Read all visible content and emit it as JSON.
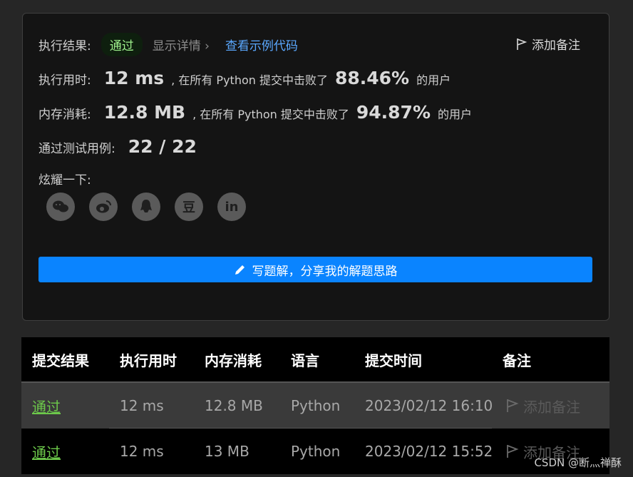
{
  "result": {
    "label": "执行结果:",
    "status": "通过",
    "detail": "显示详情 ›",
    "example": "查看示例代码",
    "add_note": "添加备注"
  },
  "runtime": {
    "label": "执行用时:",
    "value": "12 ms",
    "prefix": ", 在所有 Python 提交中击败了",
    "percent": "88.46%",
    "suffix": "的用户"
  },
  "memory": {
    "label": "内存消耗:",
    "value": "12.8 MB",
    "prefix": ", 在所有 Python 提交中击败了",
    "percent": "94.87%",
    "suffix": "的用户"
  },
  "tests": {
    "label": "通过测试用例:",
    "value": "22 / 22"
  },
  "share": {
    "label": "炫耀一下:",
    "icons": [
      "wechat-icon",
      "weibo-icon",
      "qq-icon",
      "douban-icon",
      "linkedin-icon"
    ],
    "douban_glyph": "豆",
    "linkedin_glyph": "in"
  },
  "write_button": "写题解，分享我的解题思路",
  "table": {
    "headers": [
      "提交结果",
      "执行用时",
      "内存消耗",
      "语言",
      "提交时间",
      "备注"
    ],
    "rows": [
      {
        "status": "通过",
        "runtime": "12 ms",
        "memory": "12.8 MB",
        "language": "Python",
        "time": "2023/02/12 16:10",
        "note": "添加备注"
      },
      {
        "status": "通过",
        "runtime": "12 ms",
        "memory": "13 MB",
        "language": "Python",
        "time": "2023/02/12 15:52",
        "note": "添加备注"
      }
    ]
  },
  "watermark": "CSDN @断灬禅酥",
  "colors": {
    "accent": "#0a84ff",
    "pass": "#9ef08c",
    "link": "#5aa8ff"
  }
}
